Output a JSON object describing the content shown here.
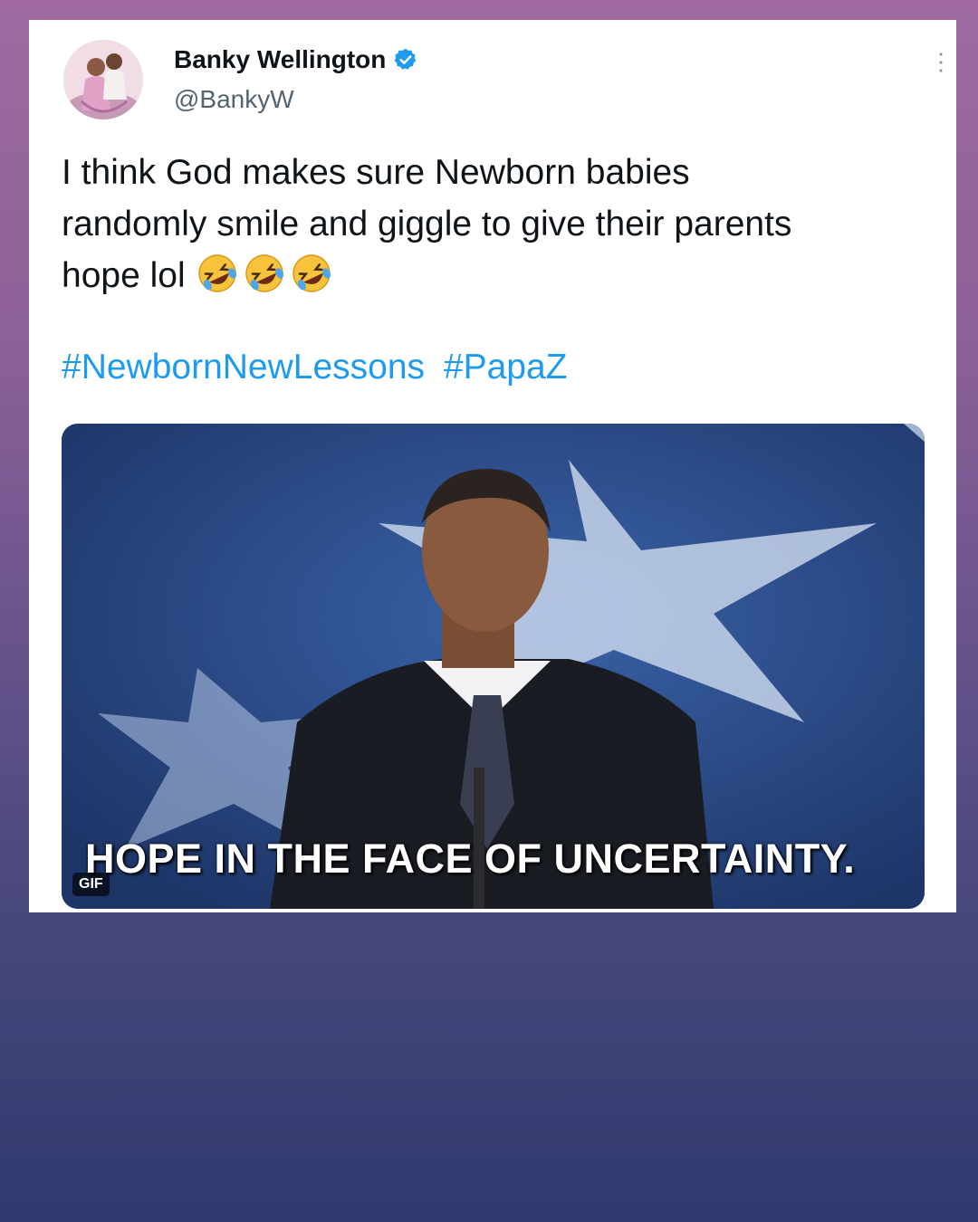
{
  "tweet": {
    "author_name": "Banky Wellington",
    "author_handle": "@BankyW",
    "verified": true,
    "text_lines": [
      "I think God makes sure Newborn babies",
      "randomly smile and giggle to give their parents",
      "hope lol"
    ],
    "emojis": [
      "rolling-on-floor-laughing",
      "rolling-on-floor-laughing",
      "rolling-on-floor-laughing"
    ],
    "hashtags": [
      "#NewbornNewLessons",
      "#PapaZ"
    ],
    "media": {
      "type": "GIF",
      "badge": "GIF",
      "caption": "HOPE IN THE FACE OF UNCERTAINTY."
    }
  },
  "colors": {
    "link": "#1d9bf0",
    "verified": "#1d9bf0",
    "text": "#0f1419",
    "handle": "#536471"
  }
}
